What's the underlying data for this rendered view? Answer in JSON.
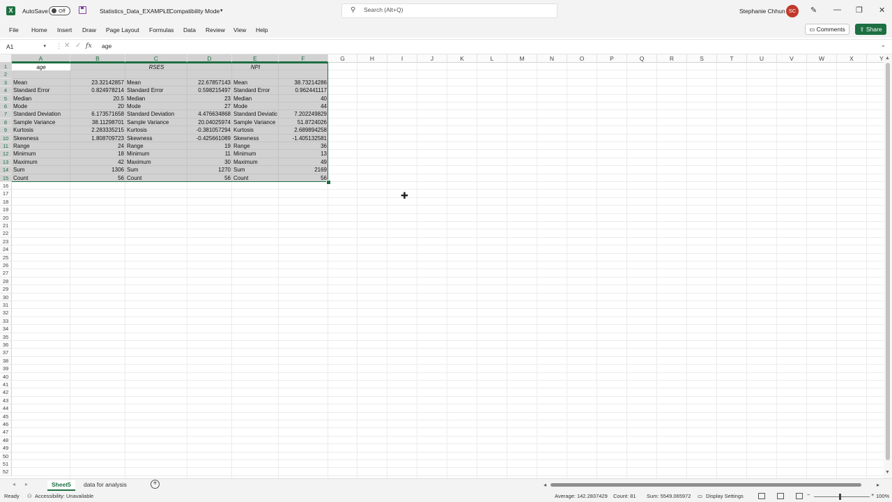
{
  "titlebar": {
    "autosave_label": "AutoSave",
    "toggle_state": "Off",
    "file_title": "Statistics_Data_EXAMPLE",
    "mode": "Compatibility Mode",
    "search_placeholder": "Search (Alt+Q)",
    "user_name": "Stephanie Chhun",
    "user_initials": "SC"
  },
  "menu": {
    "items": [
      "File",
      "Home",
      "Insert",
      "Draw",
      "Page Layout",
      "Formulas",
      "Data",
      "Review",
      "View",
      "Help"
    ],
    "comments": "Comments",
    "share": "Share"
  },
  "formula_bar": {
    "name_box": "A1",
    "fx": "fx",
    "content": "age"
  },
  "sheet": {
    "columns": [
      "A",
      "B",
      "C",
      "D",
      "E",
      "F",
      "G",
      "H",
      "I",
      "J",
      "K",
      "L",
      "M",
      "N",
      "O",
      "P",
      "Q",
      "R",
      "S",
      "T",
      "U",
      "V",
      "W",
      "X",
      "Y"
    ],
    "row_count": 52,
    "headers": {
      "a": "age",
      "c": "RSES",
      "e": "NPI"
    },
    "stats": [
      {
        "label": "Mean",
        "age": "23.32142857",
        "rses": "22.67857143",
        "npi": "38.73214286"
      },
      {
        "label": "Standard Error",
        "age": "0.824978214",
        "rses": "0.598215497",
        "npi": "0.962441117"
      },
      {
        "label": "Median",
        "age": "20.5",
        "rses": "23",
        "npi": "40"
      },
      {
        "label": "Mode",
        "age": "20",
        "rses": "27",
        "npi": "44"
      },
      {
        "label": "Standard Deviation",
        "age": "6.173571658",
        "rses": "4.476634868",
        "npi": "7.202249829",
        "label_e": "Standard Deviatic"
      },
      {
        "label": "Sample Variance",
        "age": "38.11298701",
        "rses": "20.04025974",
        "npi": "51.8724026"
      },
      {
        "label": "Kurtosis",
        "age": "2.283335215",
        "rses": "-0.381057294",
        "npi": "2.689894258"
      },
      {
        "label": "Skewness",
        "age": "1.808709723",
        "rses": "-0.425661089",
        "npi": "-1.405132581"
      },
      {
        "label": "Range",
        "age": "24",
        "rses": "19",
        "npi": "36"
      },
      {
        "label": "Minimum",
        "age": "18",
        "rses": "11",
        "npi": "13"
      },
      {
        "label": "Maximum",
        "age": "42",
        "rses": "30",
        "npi": "49"
      },
      {
        "label": "Sum",
        "age": "1306",
        "rses": "1270",
        "npi": "2169"
      },
      {
        "label": "Count",
        "age": "56",
        "rses": "56",
        "npi": "56"
      }
    ]
  },
  "tabs": [
    "Sheet5",
    "data for analysis"
  ],
  "active_tab": "Sheet5",
  "status": {
    "ready": "Ready",
    "accessibility": "Accessibility: Unavailable",
    "average": "Average: 142.2837429",
    "count": "Count: 81",
    "sum": "Sum: 5549.065972",
    "display_settings": "Display Settings",
    "zoom": "100%"
  },
  "colors": {
    "excel_green": "#1d6f42",
    "avatar_red": "#c0392b",
    "save_purple": "#7a3f9d"
  }
}
